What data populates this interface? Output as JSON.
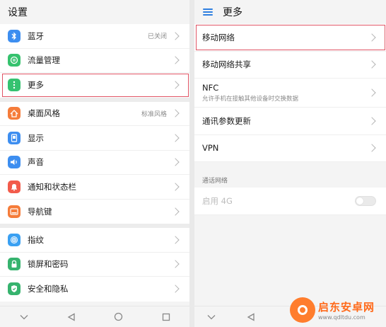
{
  "left": {
    "title": "设置",
    "groups": [
      [
        {
          "label": "蓝牙",
          "value": "已关闭",
          "icon": "bluetooth-icon",
          "color": "#3d8ef0"
        },
        {
          "label": "流量管理",
          "value": "",
          "icon": "data-usage-icon",
          "color": "#36c26e"
        },
        {
          "label": "更多",
          "value": "",
          "icon": "more-icon",
          "color": "#35c270"
        }
      ],
      [
        {
          "label": "桌面风格",
          "value": "标准风格",
          "icon": "home-icon",
          "color": "#f57c3a"
        },
        {
          "label": "显示",
          "value": "",
          "icon": "display-icon",
          "color": "#3d8ef0"
        },
        {
          "label": "声音",
          "value": "",
          "icon": "sound-icon",
          "color": "#3d8ef0"
        },
        {
          "label": "通知和状态栏",
          "value": "",
          "icon": "notification-icon",
          "color": "#f25b4b"
        },
        {
          "label": "导航键",
          "value": "",
          "icon": "navigation-key-icon",
          "color": "#f57c3a"
        }
      ],
      [
        {
          "label": "指纹",
          "value": "",
          "icon": "fingerprint-icon",
          "color": "#3aa0f2"
        },
        {
          "label": "锁屏和密码",
          "value": "",
          "icon": "lock-icon",
          "color": "#36b36e"
        },
        {
          "label": "安全和隐私",
          "value": "",
          "icon": "shield-icon",
          "color": "#36b36e"
        }
      ]
    ]
  },
  "right": {
    "title": "更多",
    "items": [
      {
        "label": "移动网络",
        "sub": ""
      },
      {
        "label": "移动网络共享",
        "sub": ""
      },
      {
        "label": "NFC",
        "sub": "允许手机在接触其他设备时交换数据"
      },
      {
        "label": "通讯参数更新",
        "sub": ""
      },
      {
        "label": "VPN",
        "sub": ""
      }
    ],
    "section": "通话网络",
    "toggle_label": "启用 4G",
    "toggle_state": "off"
  },
  "watermark": {
    "line1": "启东安卓网",
    "line2": "www.qdltdu.com"
  },
  "colors": {
    "highlight": "#e05565",
    "accent": "#2f7fe0"
  }
}
